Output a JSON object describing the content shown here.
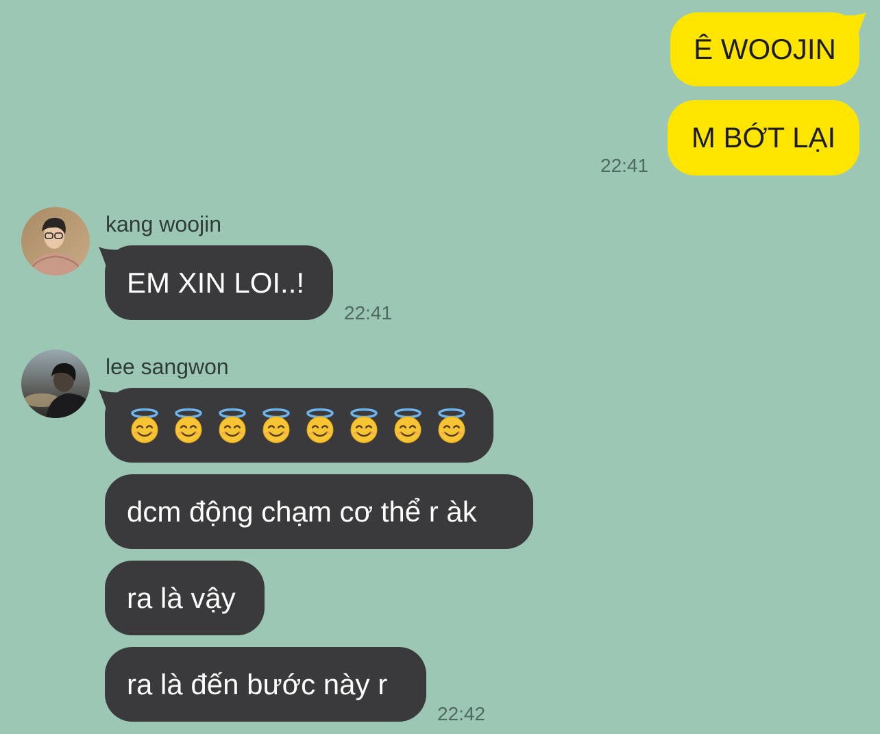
{
  "sent": {
    "messages": [
      "Ê WOOJIN",
      "M BỚT LẠI"
    ],
    "time": "22:41"
  },
  "received": [
    {
      "sender": "kang woojin",
      "avatar_icon": "person-photo-avatar",
      "messages": [
        "EM XIN LOI..!"
      ],
      "time": "22:41"
    },
    {
      "sender": "lee sangwon",
      "avatar_icon": "person-photo-avatar",
      "emoji_message": {
        "icon": "smiling-face-with-halo-emoji",
        "count": 8
      },
      "messages": [
        "dcm động chạm cơ thể r àk",
        "ra là vậy",
        "ra là đến bước này r"
      ],
      "time": "22:42"
    }
  ],
  "colors": {
    "background": "#9dc7b5",
    "sent_bubble": "#fee500",
    "received_bubble": "#3a3a3c"
  }
}
